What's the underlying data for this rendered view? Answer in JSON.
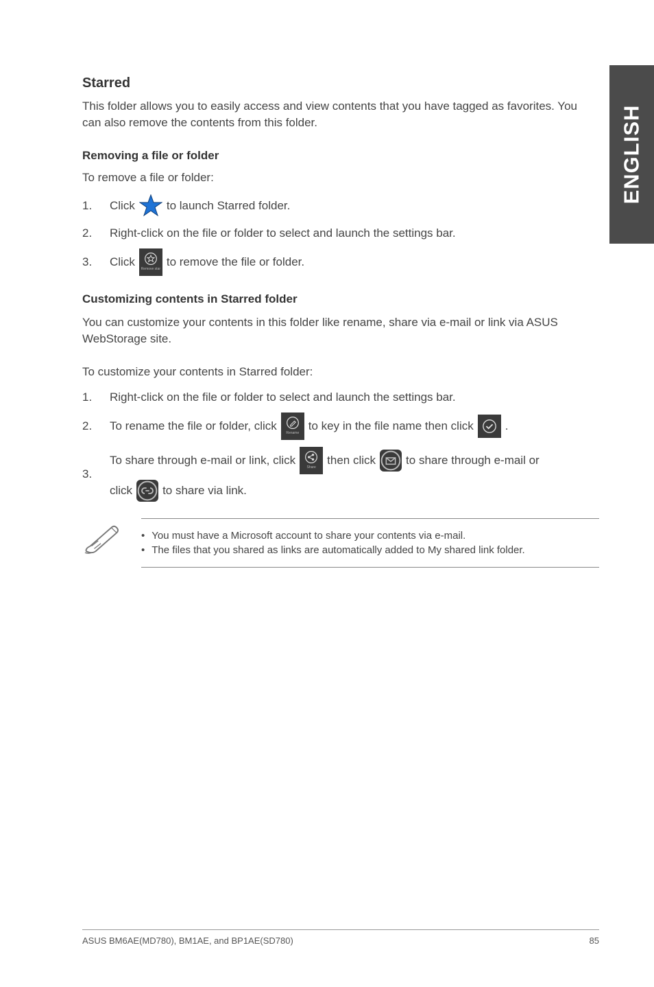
{
  "side_tab": "ENGLISH",
  "section_title": "Starred",
  "section_intro": "This folder allows you to easily access and view contents that you have tagged as favorites. You can also remove the contents from this folder.",
  "remove": {
    "heading": "Removing a file or folder",
    "lead": "To remove a file or folder:",
    "step1_a": "Click",
    "step1_b": "to launch Starred folder.",
    "step2": "Right-click on the file or folder to select and launch the settings bar.",
    "step3_a": "Click",
    "step3_b": "to remove the file or folder.",
    "remove_tile_label": "Remove star"
  },
  "customize": {
    "heading": "Customizing contents in Starred folder",
    "intro": "You can customize your contents in this folder like rename, share via e-mail or link via ASUS WebStorage site.",
    "lead": "To customize your contents in Starred folder:",
    "step1": "Right-click on the file or folder to select and launch the settings bar.",
    "step2_a": "To rename the file or folder, click",
    "step2_b": "to key in the file name then click",
    "step2_c": ".",
    "rename_tile_label": "Rename",
    "step3_a": "To share through e-mail or link, click",
    "step3_b": "then click",
    "step3_c": "to share through e-mail or",
    "step3_d": "click",
    "step3_e": "to share via link.",
    "share_tile_label": "Share"
  },
  "notes": {
    "n1": "You must have a Microsoft account to share your contents via e-mail.",
    "n2": "The files that you shared as links are automatically added to My shared link folder."
  },
  "footer": {
    "left": "ASUS BM6AE(MD780), BM1AE, and BP1AE(SD780)",
    "right": "85"
  },
  "nums": {
    "one": "1.",
    "two": "2.",
    "three": "3."
  }
}
